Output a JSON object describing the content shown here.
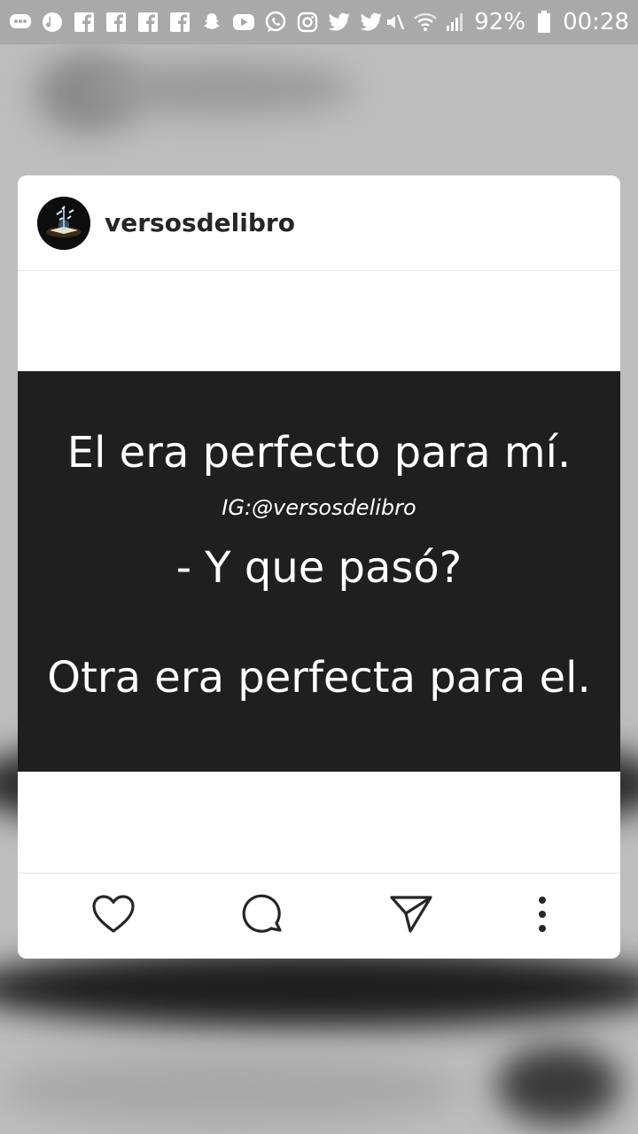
{
  "status_bar": {
    "battery": "92%",
    "time": "00:28",
    "icons": [
      "messages-icon",
      "music-icon",
      "facebook-icon",
      "facebook-icon",
      "facebook-icon",
      "facebook-icon",
      "snapchat-icon",
      "youtube-icon",
      "whatsapp-icon",
      "instagram-icon",
      "twitter-icon",
      "twitter-icon",
      "mute-icon",
      "wifi-icon",
      "signal-icon",
      "battery-icon"
    ]
  },
  "post": {
    "username": "versosdelibro",
    "line1": "El era perfecto para mí.",
    "watermark": "IG:@versosdelibro",
    "line2": "- Y que pasó?",
    "line3": "Otra era perfecta para el."
  },
  "actions": [
    "like-icon",
    "comment-icon",
    "share-icon",
    "more-options-icon"
  ],
  "colors": {
    "image_bg": "#1f1f1f",
    "card_bg": "#ffffff",
    "overlay_bg": "#bdbdbd"
  }
}
